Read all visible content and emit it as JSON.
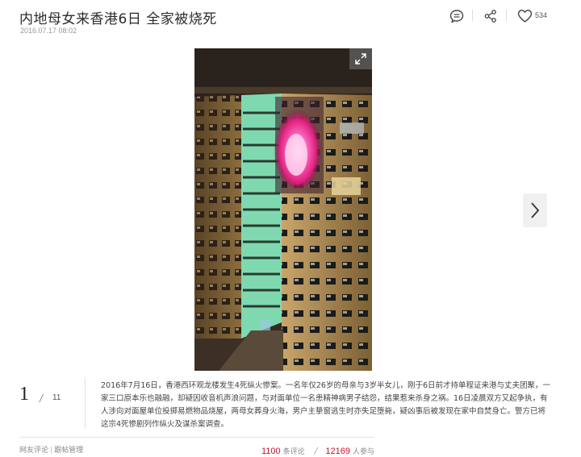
{
  "article": {
    "title": "内地母女来香港6日 全家被烧死",
    "date": "2016.07.17 08:02"
  },
  "toolbar": {
    "comment_icon": "speech-bubble-icon",
    "share_icon": "share-icon",
    "like_icon": "heart-icon",
    "like_count": "534"
  },
  "gallery": {
    "current": "1",
    "separator": "/",
    "total": "11",
    "expand_icon": "expand-arrows-icon",
    "next_icon": "chevron-right-icon",
    "caption": "2016年7月16日，香港西环观龙楼发生4死纵火惨案。一名年仅26岁的母亲与3岁半女儿，刚于6日前才持单程证来港与丈夫团聚，一家三口原本乐也融融，却疑因收音机声浪问题，与对面单位一名患精神病男子结怨，结果惹来杀身之祸。16日凌晨双方又起争执，有人涉向对面屋单位投掷易燃物品烧屋，两母女葬身火海，男户主挚窗逃生时亦失足堕毙，疑凶事后被发现在家中自焚身亡。警方已将这宗4死惨剧列作纵火及谋杀案调查。"
  },
  "footer": {
    "link_1": "网友评论",
    "pipe": "|",
    "link_2": "跟帖管理",
    "comments_count": "1100",
    "comments_label": "条评论",
    "stat_sep": "/",
    "participants_count": "12169",
    "participants_label": "人参与"
  },
  "colors": {
    "accent_red": "#c8102e",
    "fire": "#ff3fa0"
  }
}
